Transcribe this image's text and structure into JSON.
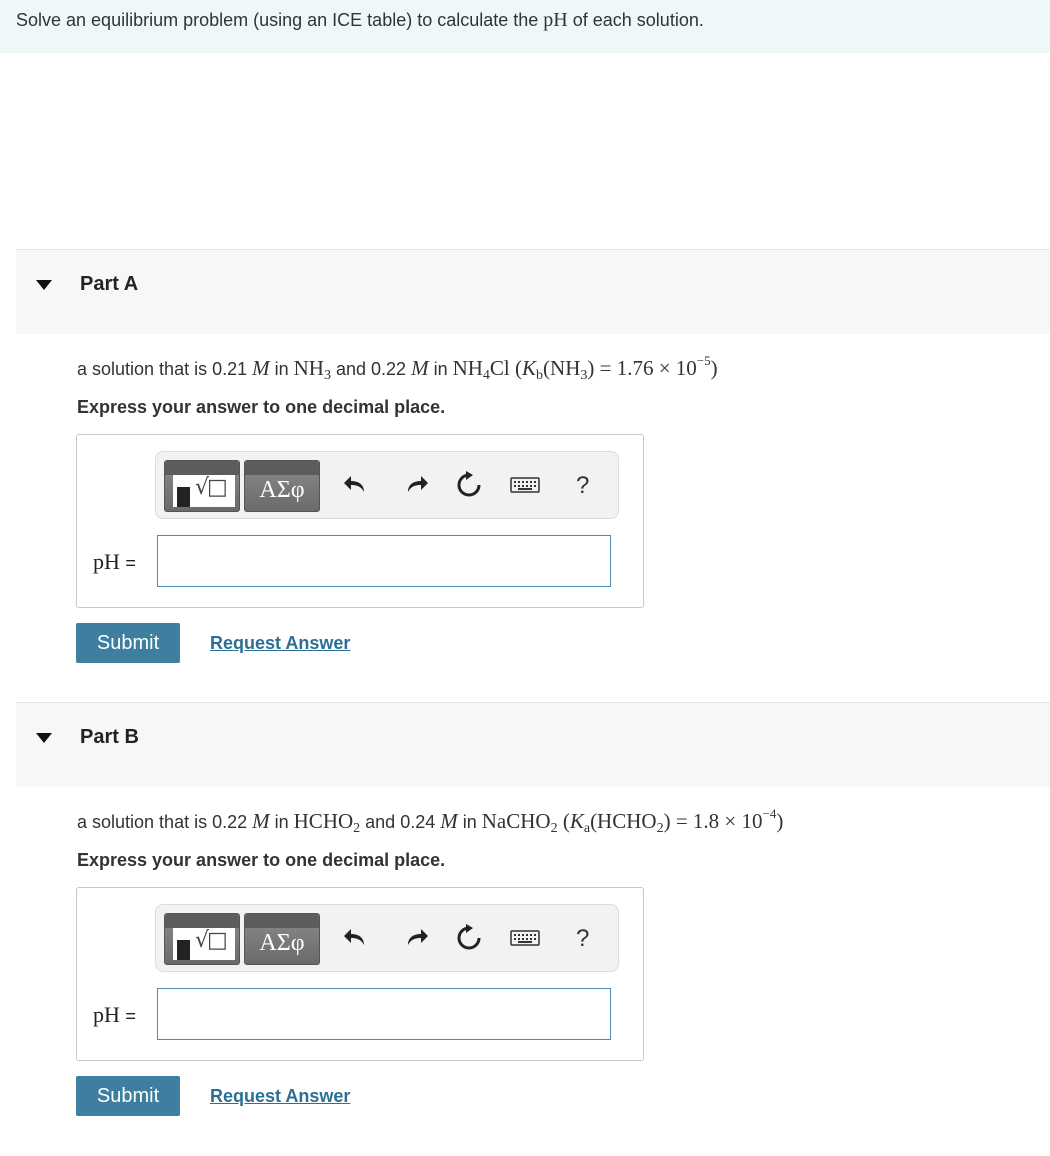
{
  "header": {
    "text_before": "Solve an equilibrium problem (using an ICE table) to calculate the ",
    "math": "pH",
    "text_after": " of each solution."
  },
  "partA": {
    "title": "Part A",
    "q_t1": "a solution that is 0.21 ",
    "q_m1": "M",
    "q_t2": " in ",
    "q_f1": "NH",
    "q_f1_sub": "3",
    "q_t3": " and 0.22 ",
    "q_m2": "M",
    "q_t4": " in ",
    "q_f2a": "NH",
    "q_f2_sub": "4",
    "q_f2b": "Cl",
    "q_k_open": "(",
    "q_k": "K",
    "q_k_sub": "b",
    "q_k_arg": "(NH",
    "q_k_arg_sub": "3",
    "q_k_arg_close": ")",
    "q_k_val": " = 1.76 × 10",
    "q_k_exp": "−5",
    "q_k_close": ")",
    "instruction": "Express your answer to one decimal place.",
    "answer_label": "pH",
    "answer_eq": "=",
    "answer_value": "",
    "submit": "Submit",
    "request": "Request Answer"
  },
  "partB": {
    "title": "Part B",
    "q_t1": "a solution that is 0.22 ",
    "q_m1": "M",
    "q_t2": " in ",
    "q_f1a": "HCHO",
    "q_f1_sub": "2",
    "q_t3": " and 0.24 ",
    "q_m2": "M",
    "q_t4": " in ",
    "q_f2a": "NaCHO",
    "q_f2_sub": "2",
    "q_k_open": "(",
    "q_k": "K",
    "q_k_sub": "a",
    "q_k_arg": "(HCHO",
    "q_k_arg_sub": "2",
    "q_k_arg_close": ")",
    "q_k_val": " = 1.8 × 10",
    "q_k_exp": "−4",
    "q_k_close": ")",
    "instruction": "Express your answer to one decimal place.",
    "answer_label": "pH",
    "answer_eq": "=",
    "answer_value": "",
    "submit": "Submit",
    "request": "Request Answer"
  },
  "toolbar": {
    "templates_text": "√□",
    "symbols_label": "ΑΣφ",
    "help_label": "?",
    "icons": [
      "templates-icon",
      "greek-symbols-icon",
      "undo-icon",
      "redo-icon",
      "reset-icon",
      "keyboard-icon",
      "help-icon"
    ]
  }
}
